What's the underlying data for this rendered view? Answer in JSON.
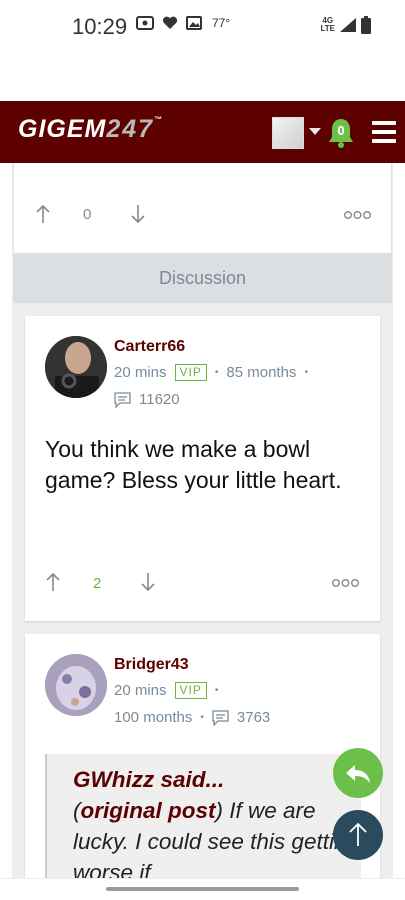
{
  "status_bar": {
    "time": "10:29",
    "temperature": "77°",
    "network": "4G\nLTE"
  },
  "header": {
    "logo_text": "GIGEM",
    "logo_num": "247",
    "logo_tm": "™",
    "notification_count": "0"
  },
  "top_post": {
    "vote_count": "0"
  },
  "discussion": {
    "label": "Discussion"
  },
  "posts": [
    {
      "username": "Carterr66",
      "time": "20 mins",
      "badge": "VIP",
      "tenure": "85 months",
      "post_count": "11620",
      "body": "You think we make a bowl game? Bless your little heart.",
      "vote_count": "2"
    },
    {
      "username": "Bridger43",
      "time": "20 mins",
      "badge": "VIP",
      "tenure": "100 months",
      "post_count": "3763",
      "quote_author": "GWhizz said...",
      "quote_link": "original post",
      "quote_text": " If we are lucky. I could see this getting worse if"
    }
  ],
  "colors": {
    "brand": "#5c0000",
    "accent_green": "#6cc04a",
    "fab_dark": "#2a4a5e",
    "vip_green": "#6db33f"
  }
}
